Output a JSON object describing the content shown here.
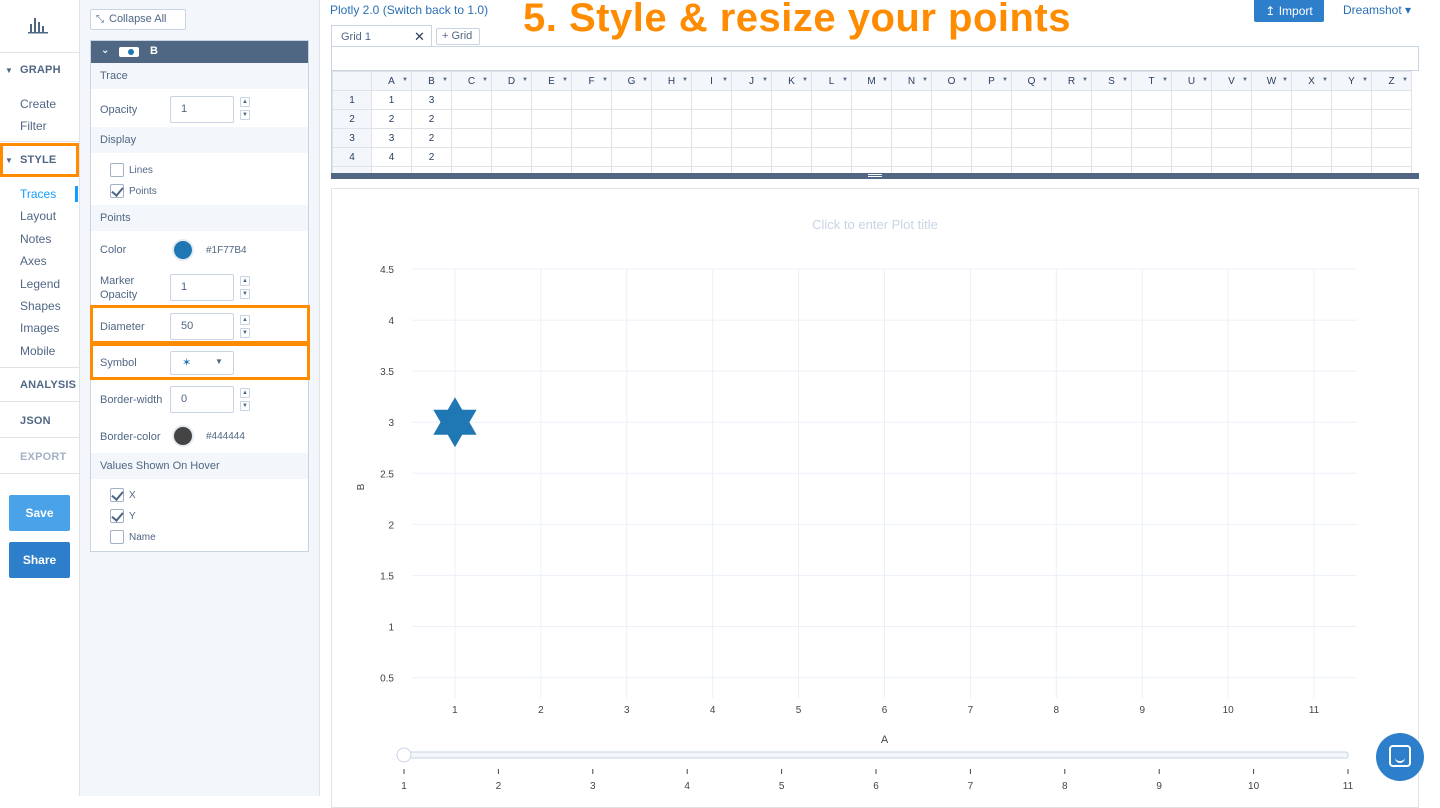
{
  "headline": "5. Style & resize your points",
  "top": {
    "version_label": "Plotly 2.0 (Switch back to 1.0)",
    "import_label": "Import",
    "user_menu": "Dreamshot ▾"
  },
  "nav": {
    "graph": "GRAPH",
    "graph_items": [
      "Create",
      "Filter"
    ],
    "style": "STYLE",
    "style_items": [
      "Traces",
      "Layout",
      "Notes",
      "Axes",
      "Legend",
      "Shapes",
      "Images",
      "Mobile"
    ],
    "analysis": "ANALYSIS",
    "json": "JSON",
    "export": "EXPORT",
    "save": "Save",
    "share": "Share"
  },
  "panel": {
    "collapse_all": "Collapse All",
    "trace_name": "B",
    "trace_section": "Trace",
    "opacity_label": "Opacity",
    "opacity_value": "1",
    "display_section": "Display",
    "lines_label": "Lines",
    "lines_checked": false,
    "points_label": "Points",
    "points_checked": true,
    "points_section": "Points",
    "color_label": "Color",
    "color_value": "#1F77B4",
    "marker_opacity_label_1": "Marker",
    "marker_opacity_label_2": "Opacity",
    "marker_opacity_value": "1",
    "diameter_label": "Diameter",
    "diameter_value": "50",
    "symbol_label": "Symbol",
    "symbol_value": "✶",
    "border_width_label": "Border-width",
    "border_width_value": "0",
    "border_color_label": "Border-color",
    "border_color_value": "#444444",
    "hover_section": "Values Shown On Hover",
    "hover_x": "X",
    "hover_y": "Y",
    "hover_name": "Name"
  },
  "grid": {
    "tab_label": "Grid 1",
    "add_tab_label": "Grid",
    "columns": [
      "A",
      "B",
      "C",
      "D",
      "E",
      "F",
      "G",
      "H",
      "I",
      "J",
      "K",
      "L",
      "M",
      "N",
      "O",
      "P",
      "Q",
      "R",
      "S",
      "T",
      "U",
      "V",
      "W",
      "X",
      "Y",
      "Z"
    ],
    "rows": [
      {
        "num": "1",
        "A": "1",
        "B": "3"
      },
      {
        "num": "2",
        "A": "2",
        "B": "2"
      },
      {
        "num": "3",
        "A": "3",
        "B": "2"
      },
      {
        "num": "4",
        "A": "4",
        "B": "2"
      }
    ]
  },
  "chart_data": {
    "type": "scatter",
    "title": "Click to enter Plot title",
    "xlabel": "A",
    "ylabel": "B",
    "xlim": [
      0.5,
      11.5
    ],
    "ylim": [
      0.3,
      4.5
    ],
    "x_ticks": [
      1,
      2,
      3,
      4,
      5,
      6,
      7,
      8,
      9,
      10,
      11
    ],
    "y_ticks": [
      0.5,
      1,
      1.5,
      2,
      2.5,
      3,
      3.5,
      4,
      4.5
    ],
    "series": [
      {
        "x": [
          1
        ],
        "y": [
          3
        ],
        "marker_symbol": "star-6",
        "marker_color": "#1F77B4"
      }
    ],
    "rangeslider_ticks": [
      1,
      2,
      3,
      4,
      5,
      6,
      7,
      8,
      9,
      10,
      11
    ],
    "grid": true
  },
  "colors": {
    "accent": "#ff8c00",
    "primary": "#2d7ecb",
    "trace": "#1F77B4",
    "border": "#444444"
  }
}
